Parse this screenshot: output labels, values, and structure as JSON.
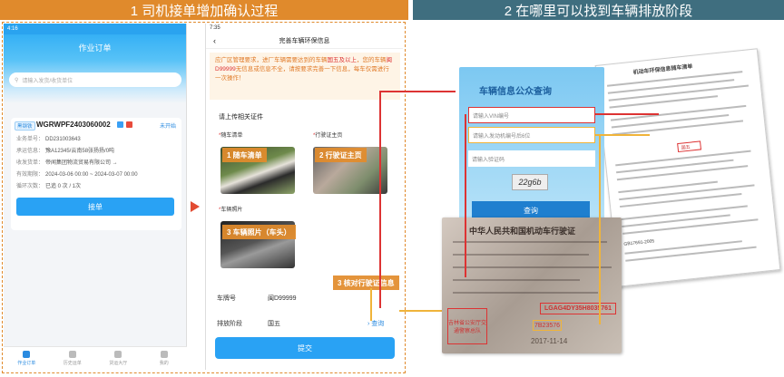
{
  "headers": {
    "left": "1 司机接单增加确认过程",
    "right": "2 在哪里可以找到车辆排放阶段"
  },
  "phone1": {
    "status_time": "4:16",
    "title": "作业订单",
    "search_placeholder": "请输入发货/收货单位",
    "order": {
      "tag": "黑钢铁",
      "order_no": "WGRWPF2403060002",
      "status": "未开始",
      "rows": [
        {
          "k": "业务单号：",
          "v": "DD231003643"
        },
        {
          "k": "承运信息：",
          "v": "豫A12345/云南58张扬扬/0吨"
        },
        {
          "k": "收发货单：",
          "v": "帝闻集团物流贸易有限公司 →"
        },
        {
          "k": "有效期限：",
          "v": "2024-03-06 00:00 ~ 2024-03-07 00:00"
        },
        {
          "k": "循环次数：",
          "v": "已追 0 次 / 1次"
        }
      ],
      "button": "接单"
    },
    "tabs": [
      "作业订单",
      "历史运单",
      "货运大厅",
      "我的"
    ]
  },
  "phone2": {
    "status_time": "7:35",
    "nav_title": "完善车辆环保信息",
    "notice_pre": "应广区管理要求，进厂车辆需要达到的车辆",
    "notice_red1": "国五及以上",
    "notice_mid": "，您的车辆",
    "notice_red2": "闽D99999",
    "notice_post": "无信息或信息不全，请按要求完善一下信息，每车仅需进行一次操作！",
    "upload_title": "请上传相关证件",
    "slots": {
      "s1": "随车清单",
      "s2": "行驶证主页",
      "s3": "车辆照片"
    },
    "labels": {
      "l1": "1 随车清单",
      "l2": "2 行驶证主页",
      "l3": "3 车辆照片（车头）",
      "l4": "3 核对行驶证信息"
    },
    "fields": {
      "plate_k": "车牌号",
      "plate_v": "闽D99999",
      "stage_k": "排放阶段",
      "stage_v": "国五",
      "query": "查询"
    },
    "submit": "提交"
  },
  "query_page": {
    "title": "车辆信息公众查询",
    "vin_placeholder": "请输入VIN编号",
    "engine_placeholder": "请输入发动机编号后6位",
    "captcha_placeholder": "请输入验证码",
    "captcha": "22g6b",
    "button": "查询"
  },
  "license": {
    "title": "中华人民共和国机动车行驶证",
    "vin": "LGAG4DY35H8035761",
    "engine": "7B23576",
    "seal": "吉林省公安厅交通警察总队",
    "date": "2017-11-14"
  },
  "doc": {
    "title": "机动车环保信息随车清单",
    "row1": "国五",
    "row2": "GB17691-2005"
  },
  "colors": {
    "orange": "#e08a2c",
    "teal": "#3f6e7f",
    "blue": "#29a2f4",
    "red": "#d33333",
    "yellow": "#f0b43a"
  }
}
